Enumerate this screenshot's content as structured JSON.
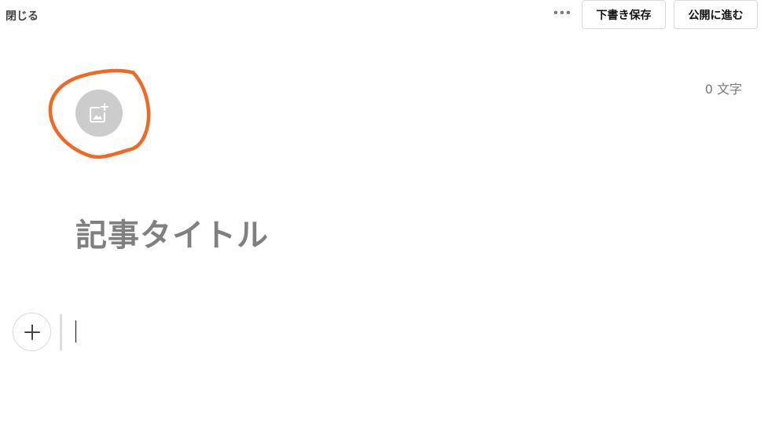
{
  "header": {
    "close_label": "閉じる",
    "more_icon": "more-horizontal-icon",
    "draft_save_label": "下書き保存",
    "publish_label": "公開に進む"
  },
  "editor": {
    "char_count": "0 文字",
    "eyecatch_icon": "add-image-icon",
    "title_placeholder": "記事タイトル",
    "add_block_icon": "plus-icon"
  },
  "colors": {
    "annotation": "#f26722",
    "eyecatch_bg": "#cccccc",
    "title_placeholder": "#808080"
  }
}
